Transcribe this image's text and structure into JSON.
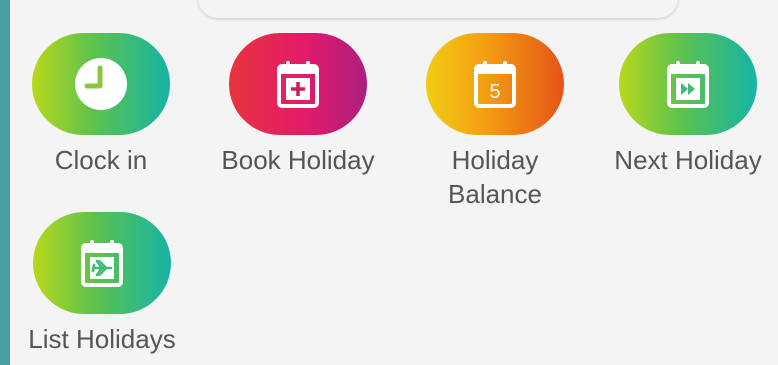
{
  "colors": {
    "frame": "#4a9ea6",
    "panel": "#f4f4f4",
    "label": "#555555",
    "gradient_green": [
      "#b8d81c",
      "#5cc24e",
      "#16b3a6"
    ],
    "gradient_pink": [
      "#e8333c",
      "#e21b6a",
      "#ab1f7f"
    ],
    "gradient_orange": [
      "#f2cc14",
      "#f39c12",
      "#e5531a"
    ]
  },
  "tiles": [
    {
      "label": "Clock in",
      "icon": "clock-icon"
    },
    {
      "label": "Book Holiday",
      "icon": "calendar-plus-icon"
    },
    {
      "label": "Holiday\nBalance",
      "icon": "calendar-number-icon",
      "badge": "5"
    },
    {
      "label": "Next Holiday",
      "icon": "calendar-fast-forward-icon"
    },
    {
      "label": "List Holidays",
      "icon": "calendar-plane-icon"
    }
  ]
}
